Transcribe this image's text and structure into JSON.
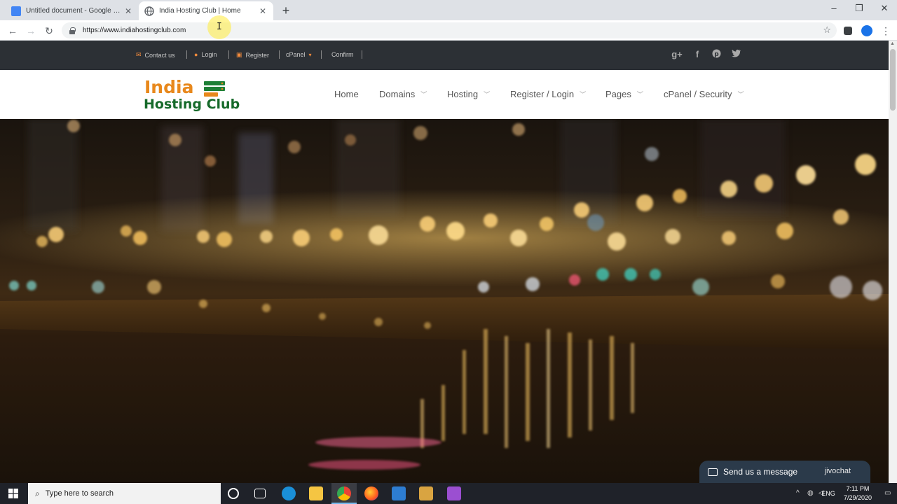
{
  "browser": {
    "tabs": [
      {
        "title": "Untitled document - Google Docs",
        "active": false,
        "favicon": "google-docs-icon"
      },
      {
        "title": "India Hosting Club | Home",
        "active": true,
        "favicon": "globe-icon"
      }
    ],
    "new_tab": "+",
    "window_controls": {
      "minimize": "–",
      "maximize": "❐",
      "close": "✕"
    },
    "url": "https://www.indiahostingclub.com"
  },
  "site": {
    "topbar": {
      "items": [
        {
          "icon": "envelope-icon",
          "label": "Contact us"
        },
        {
          "icon": "user-icon",
          "label": "Login"
        },
        {
          "icon": "register-icon",
          "label": "Register"
        },
        {
          "icon": "",
          "label": "cPanel"
        },
        {
          "icon": "",
          "label": "Confirm"
        }
      ],
      "social": [
        "google-plus-icon",
        "facebook-icon",
        "pinterest-icon",
        "twitter-icon"
      ]
    },
    "logo": {
      "line1": "India",
      "line2": "Hosting Club"
    },
    "nav": [
      {
        "label": "Home",
        "dropdown": false
      },
      {
        "label": "Domains",
        "dropdown": true
      },
      {
        "label": "Hosting",
        "dropdown": true
      },
      {
        "label": "Register / Login",
        "dropdown": true
      },
      {
        "label": "Pages",
        "dropdown": true
      },
      {
        "label": "cPanel / Security",
        "dropdown": true
      }
    ],
    "chat": {
      "label": "Send us a message",
      "brand": "jivochat"
    }
  },
  "taskbar": {
    "search_placeholder": "Type here to search",
    "apps": [
      "cortana-icon",
      "task-view-icon",
      "edge-icon",
      "file-explorer-icon",
      "chrome-icon",
      "firefox-icon",
      "app-icon",
      "app-icon-2",
      "app-icon-3"
    ],
    "time": "7:11 PM",
    "date": "7/29/2020",
    "language": "ENG"
  },
  "colors": {
    "topbar_bg": "#2c3035",
    "logo_orange": "#e8881c",
    "logo_green": "#166a2a",
    "accent_orange": "#f08a3c",
    "chat_bg": "#2b3a4a"
  }
}
